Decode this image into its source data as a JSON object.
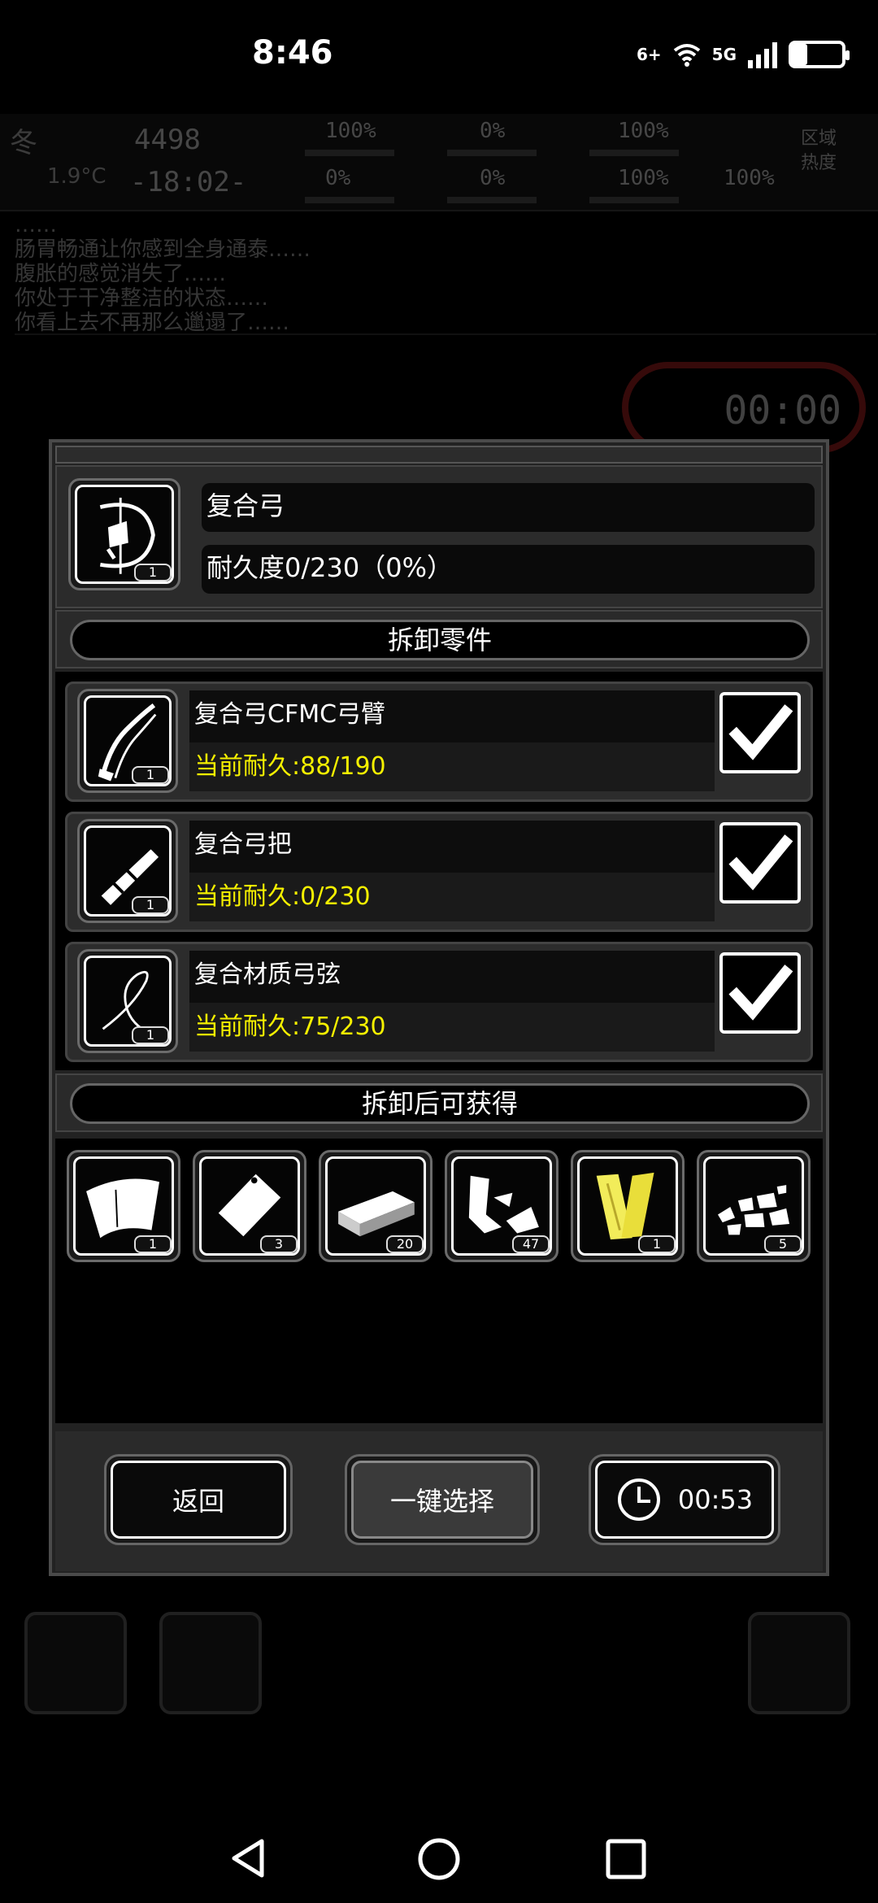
{
  "status_bar": {
    "time": "8:46",
    "network_wifi": "6+",
    "network_cell": "5G",
    "battery_level": 0.3
  },
  "hud": {
    "season": "冬",
    "temperature": "1.9°C",
    "day_counter": "4498",
    "clock": "-18:02-",
    "stats": [
      "100%",
      "0%",
      "100%",
      "0%",
      "0%",
      "100%",
      "100%"
    ],
    "zone_label": "区域热度"
  },
  "log": {
    "lines": [
      "……",
      "肠胃畅通让你感到全身通泰……",
      "腹胀的感觉消失了……",
      "你处于干净整洁的状态……",
      "你看上去不再那么邋遢了……"
    ]
  },
  "background_timer": "00:00",
  "item": {
    "icon": "compound-bow-icon",
    "count": "1",
    "name": "复合弓",
    "durability": "耐久度0/230（0%）"
  },
  "parts_section_title": "拆卸零件",
  "parts": [
    {
      "icon": "bow-limb-icon",
      "count": "1",
      "name": "复合弓CFMC弓臂",
      "durability": "当前耐久:88/190",
      "checked": true
    },
    {
      "icon": "bow-grip-icon",
      "count": "1",
      "name": "复合弓把",
      "durability": "当前耐久:0/230",
      "checked": true
    },
    {
      "icon": "bow-string-icon",
      "count": "1",
      "name": "复合材质弓弦",
      "durability": "当前耐久:75/230",
      "checked": true
    }
  ],
  "yield_section_title": "拆卸后可获得",
  "yields": [
    {
      "icon": "fabric-sheet-icon",
      "count": "1"
    },
    {
      "icon": "plastic-piece-icon",
      "count": "3"
    },
    {
      "icon": "metal-ingot-icon",
      "count": "20"
    },
    {
      "icon": "scrap-metal-icon",
      "count": "47"
    },
    {
      "icon": "wood-plank-icon",
      "count": "1"
    },
    {
      "icon": "debris-pile-icon",
      "count": "5"
    }
  ],
  "footer": {
    "back_label": "返回",
    "select_all_label": "一键选择",
    "timer_label": "00:53"
  },
  "colors": {
    "durability_text": "#f5f000",
    "dialog_bg": "#222222",
    "accent_red": "#aa2222"
  }
}
